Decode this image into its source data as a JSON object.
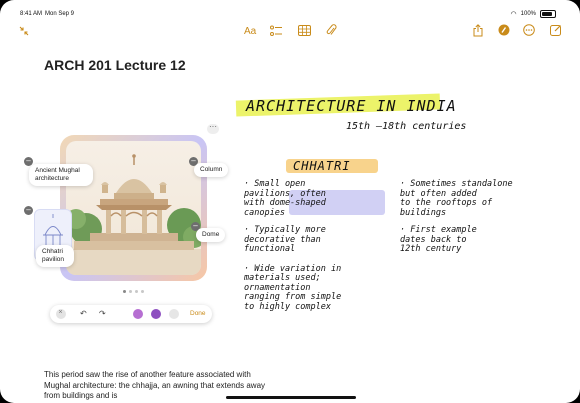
{
  "status": {
    "time": "8:41 AM",
    "date": "Mon Sep 9",
    "battery": "100%"
  },
  "toolbar": {
    "format_label": "Aa",
    "done_label": "Done"
  },
  "note": {
    "title": "ARCH 201 Lecture 12"
  },
  "image_labels": {
    "mughal": "Ancient Mughal architecture",
    "column": "Column",
    "dome": "Dome",
    "chhatri_pavilion": "Chhatri pavilion"
  },
  "paragraph": "This period saw the rise of another feature associated with Mughal architecture: the chhajja, an awning that extends away from buildings and is",
  "handwriting": {
    "heading": "ARCHITECTURE IN INDIA",
    "dates": "15th –18th centuries",
    "subheading": "CHHATRI",
    "col1": [
      "· Small open",
      "  pavilions, often",
      "  with dome-shaped",
      "  canopies",
      "· Typically more",
      "  decorative than",
      "  functional",
      "· Wide variation in",
      "  materials used;",
      "  ornamentation",
      "  ranging from simple",
      "  to highly complex"
    ],
    "col2": [
      "· Sometimes standalone",
      "  but often added",
      "  to the rooftops of",
      "  buildings",
      "· First example",
      "  dates back to",
      "  12th century"
    ]
  },
  "colors": {
    "accent": "#c98b1a",
    "highlight": "#ecf36a",
    "subhighlight": "#f8d38c",
    "selection": "#c6c4f1"
  },
  "icons": [
    "collapse-icon",
    "format-icon",
    "checklist-icon",
    "table-icon",
    "attachment-icon",
    "share-icon",
    "markup-icon",
    "more-icon",
    "compose-icon"
  ]
}
